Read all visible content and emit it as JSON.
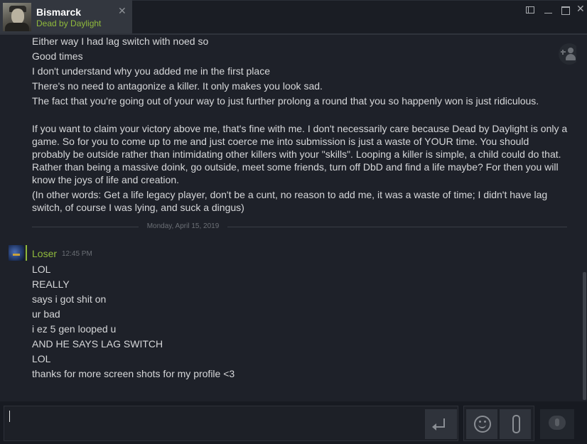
{
  "window": {
    "tab": {
      "name": "Bismarck",
      "game": "Dead by Daylight",
      "close_glyph": "✕"
    },
    "controls": {
      "close_glyph": "✕"
    }
  },
  "chat": {
    "earlier_messages": [
      "Either way I had lag switch with noed so",
      "Good times",
      "I don't understand why you added me in the first place",
      "There's no need to antagonize a killer. It only makes you look sad.",
      "The fact that you're going out of your way to just further prolong a round that you so happenly won is just ridiculous.",
      "If you want to claim your victory above me, that's fine with me. I don't necessarily care because Dead by Daylight is only a game. So for you to come up to me and just coerce me into submission is just a waste of YOUR time. You should probably be outside rather than intimidating other killers with your \"skills\". Looping a killer is simple, a child could do that. Rather than being a massive doink, go outside, meet some friends, turn off DbD and find a life maybe? For then you will know the joys of life and creation.",
      "(In other words: Get a life legacy player, don't be a cunt, no reason to add me, it was a waste of time; I didn't have lag switch, of course I was lying, and suck a dingus)"
    ],
    "date_divider": "Monday, April 15, 2019",
    "sender": {
      "name": "Loser",
      "time": "12:45 PM"
    },
    "messages": [
      "LOL",
      "REALLY",
      "says i got shit on",
      "ur bad",
      "i ez 5 gen looped u",
      "AND HE SAYS LAG SWITCH",
      "LOL",
      "thanks for more screen shots for my profile <3"
    ]
  },
  "input": {
    "value": ""
  },
  "colors": {
    "accent_green": "#90ba3c",
    "background": "#1e2129",
    "input_bar": "#171a21"
  },
  "icons": [
    "close-icon",
    "layout-icon",
    "minimize-icon",
    "maximize-icon",
    "add-friend-icon",
    "send-icon",
    "emoji-icon",
    "attach-icon",
    "voice-icon"
  ]
}
